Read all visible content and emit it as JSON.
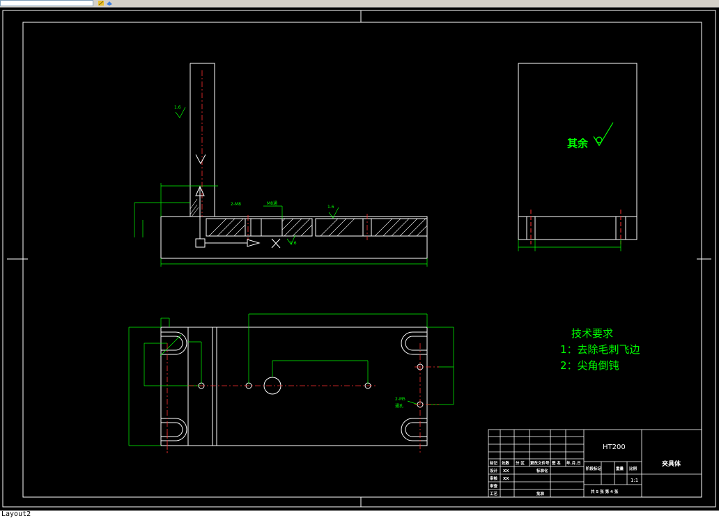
{
  "app": {
    "layout_tab": "Layout2"
  },
  "drawing": {
    "surface_note": "其余",
    "tech_title": "技术要求",
    "tech_items": [
      "1：去除毛刺飞边",
      "2：尖角倒钝"
    ],
    "front_labels": {
      "thread_1": "2-M8",
      "thread_2": "M8通",
      "rough_1": "1.6",
      "rough_2": "1.6",
      "rough_3": "1.6"
    },
    "plan_labels": {
      "thread": "2-M5",
      "thread_note": "通孔"
    }
  },
  "title_block": {
    "material": "HT200",
    "part_name": "夹具体",
    "scale": "1:1",
    "header_cells": [
      "标记",
      "处数",
      "分 区",
      "更改文件号",
      "签 名",
      "年.月.日"
    ],
    "rows": [
      {
        "label": "设计",
        "value": "XX",
        "extra": "标准化"
      },
      {
        "label": "审核",
        "value": "XX",
        "extra": ""
      },
      {
        "label": "审查",
        "value": "",
        "extra": ""
      },
      {
        "label": "工艺",
        "value": "",
        "extra": "批准"
      }
    ],
    "stage_headers": [
      "阶段标记",
      "重量",
      "比例"
    ],
    "sheet_info": "共 5 张  第 4 张"
  },
  "colors": {
    "line": "#ffffff",
    "green": "#00ff00",
    "red": "#ff3030",
    "background": "#000000"
  }
}
